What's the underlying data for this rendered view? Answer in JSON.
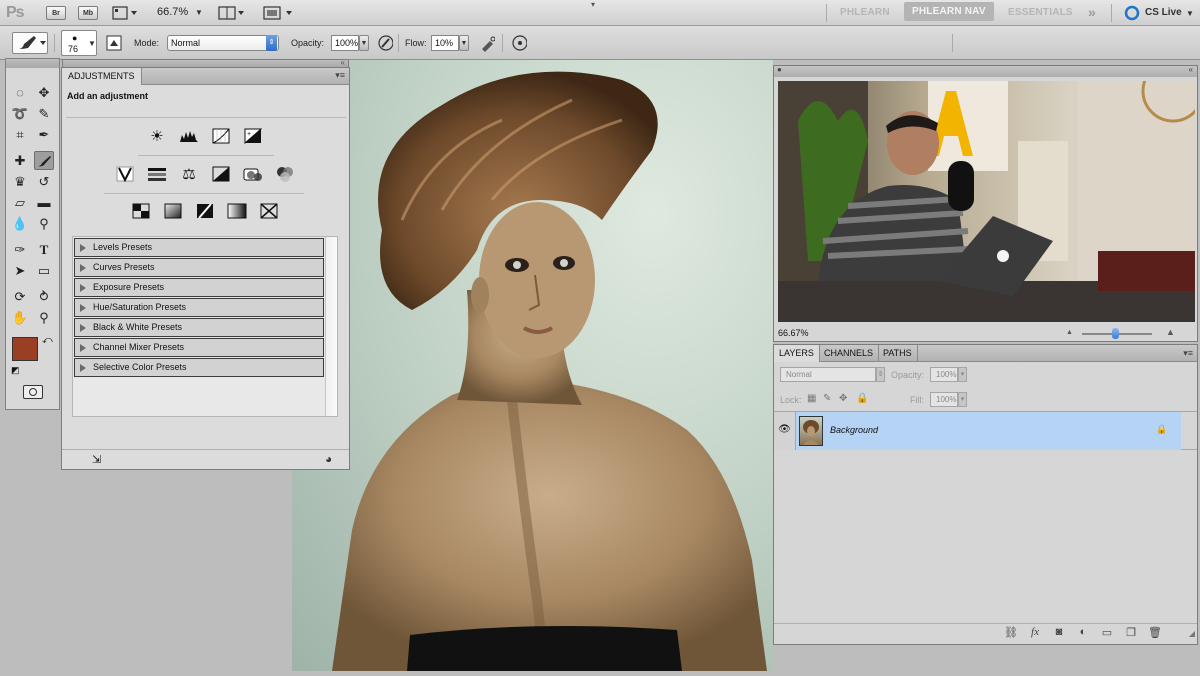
{
  "app": {
    "logo": "Ps",
    "bridge_btn": "Br",
    "minibridge_btn": "Mb",
    "zoom": "66.7%",
    "workspaces": [
      "PHLEARN",
      "PHLEARN NAV",
      "ESSENTIALS"
    ],
    "active_workspace": "PHLEARN NAV",
    "cs_live": "CS Live"
  },
  "options": {
    "brush_size": "76",
    "mode_label": "Mode:",
    "mode_value": "Normal",
    "opacity_label": "Opacity:",
    "opacity_value": "100%",
    "flow_label": "Flow:",
    "flow_value": "10%"
  },
  "tools": {
    "foreground_color": "#9b3f24",
    "background_color": "#f2f2f2"
  },
  "adjustments": {
    "tab": "ADJUSTMENTS",
    "heading": "Add an adjustment",
    "presets": [
      "Levels Presets",
      "Curves Presets",
      "Exposure Presets",
      "Hue/Saturation Presets",
      "Black & White Presets",
      "Channel Mixer Presets",
      "Selective Color Presets"
    ]
  },
  "video": {
    "zoom": "66.67%"
  },
  "layers": {
    "tabs": [
      "LAYERS",
      "CHANNELS",
      "PATHS"
    ],
    "blend_mode": "Normal",
    "opacity_label": "Opacity:",
    "opacity_value": "100%",
    "lock_label": "Lock:",
    "fill_label": "Fill:",
    "fill_value": "100%",
    "layer_name": "Background",
    "selected_color": "#b5d3f5"
  }
}
